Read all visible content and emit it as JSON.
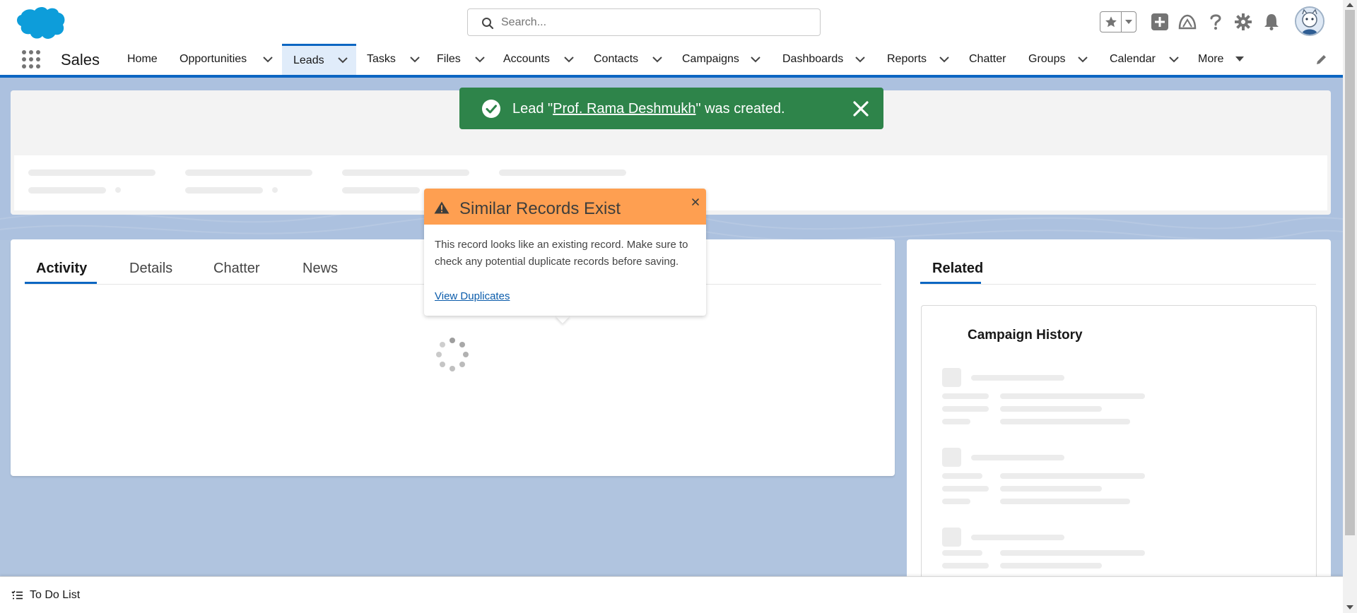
{
  "header": {
    "search": {
      "placeholder": "Search...",
      "value": ""
    },
    "icons": [
      "favorites-star-icon",
      "favorites-dropdown-icon",
      "global-actions-icon",
      "trailhead-icon",
      "help-icon",
      "setup-gear-icon",
      "notifications-bell-icon",
      "avatar"
    ]
  },
  "nav": {
    "app_name": "Sales",
    "items": [
      {
        "label": "Home",
        "has_menu": false,
        "active": false
      },
      {
        "label": "Opportunities",
        "has_menu": true,
        "active": false
      },
      {
        "label": "Leads",
        "has_menu": true,
        "active": true
      },
      {
        "label": "Tasks",
        "has_menu": true,
        "active": false
      },
      {
        "label": "Files",
        "has_menu": true,
        "active": false
      },
      {
        "label": "Accounts",
        "has_menu": true,
        "active": false
      },
      {
        "label": "Contacts",
        "has_menu": true,
        "active": false
      },
      {
        "label": "Campaigns",
        "has_menu": true,
        "active": false
      },
      {
        "label": "Dashboards",
        "has_menu": true,
        "active": false
      },
      {
        "label": "Reports",
        "has_menu": true,
        "active": false
      },
      {
        "label": "Chatter",
        "has_menu": false,
        "active": false
      },
      {
        "label": "Groups",
        "has_menu": true,
        "active": false
      },
      {
        "label": "Calendar",
        "has_menu": true,
        "active": false
      },
      {
        "label": "More",
        "has_menu": true,
        "active": false
      }
    ]
  },
  "toast": {
    "prefix": "Lead \"",
    "record_name": "Prof. Rama Deshmukh",
    "suffix": "\" was created.",
    "color": "#2e844a"
  },
  "duplicate_popover": {
    "title": "Similar Records Exist",
    "body": "This record looks like an existing record. Make sure to check any potential duplicate records before saving.",
    "link": "View Duplicates",
    "header_color": "#fe9f51"
  },
  "record_tabs": {
    "tabs": [
      "Activity",
      "Details",
      "Chatter",
      "News"
    ],
    "active": "Activity"
  },
  "related": {
    "tab": "Related",
    "campaign_history_title": "Campaign History"
  },
  "utility_bar": {
    "todo_label": "To Do List"
  },
  "colors": {
    "brand_blue": "#0c66c2",
    "page_background": "#b0c4df",
    "success_green": "#2e844a",
    "warning_orange": "#fe9f51"
  }
}
